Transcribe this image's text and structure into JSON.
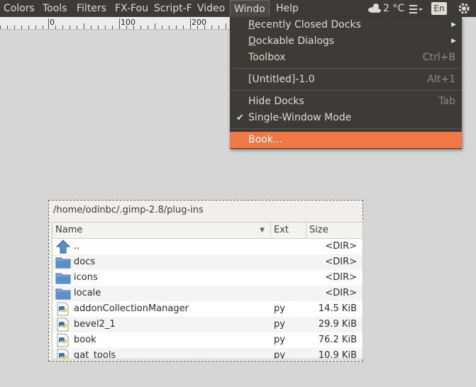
{
  "menubar": {
    "items": [
      "Colors",
      "Tools",
      "Filters",
      "FX-Fou",
      "Script-F",
      "Video",
      "Windo",
      "Help"
    ]
  },
  "indicators": {
    "weather_temp": "2 °C",
    "weather_icon": "cloud-weather-icon",
    "menu_icon": "hamburger-menu-icon",
    "keyboard_layout": "En"
  },
  "ruler": {
    "labels": [
      "0",
      "100",
      "200"
    ]
  },
  "windows_menu": {
    "items": [
      {
        "label": "Recently Closed Docks",
        "mnemonic": "R",
        "rest": "ecently Closed Docks",
        "submenu": true
      },
      {
        "label": "Dockable Dialogs",
        "mnemonic": "D",
        "rest": "ockable Dialogs",
        "submenu": true
      },
      {
        "label": "Toolbox",
        "accel": "Ctrl+B"
      },
      {
        "label": "[Untitled]-1.0",
        "accel": "Alt+1"
      },
      {
        "label": "Hide Docks",
        "accel": "Tab"
      },
      {
        "label": "Single-Window Mode",
        "checked": true,
        "check_icon": "checkmark-icon"
      },
      {
        "label": "Book...",
        "highlighted": true
      }
    ],
    "highlight_color": "#f07746"
  },
  "file_selector": {
    "path": "/home/odinbc/.gimp-2.8/plug-ins",
    "columns": [
      "Name",
      "Ext",
      "Size"
    ],
    "rows": [
      {
        "name": "..",
        "ext": "",
        "size": "<DIR>",
        "icon": "up-arrow-icon"
      },
      {
        "name": "docs",
        "ext": "",
        "size": "<DIR>",
        "icon": "folder-icon"
      },
      {
        "name": "icons",
        "ext": "",
        "size": "<DIR>",
        "icon": "folder-icon"
      },
      {
        "name": "locale",
        "ext": "",
        "size": "<DIR>",
        "icon": "folder-icon"
      },
      {
        "name": "addonCollectionManager",
        "ext": "py",
        "size": "14.5 KiB",
        "icon": "python-file-icon"
      },
      {
        "name": "bevel2_1",
        "ext": "py",
        "size": "29.9 KiB",
        "icon": "python-file-icon"
      },
      {
        "name": "book",
        "ext": "py",
        "size": "76.2 KiB",
        "icon": "python-file-icon"
      },
      {
        "name": "gat_tools",
        "ext": "py",
        "size": "10.9 KiB",
        "icon": "python-file-icon"
      }
    ]
  }
}
